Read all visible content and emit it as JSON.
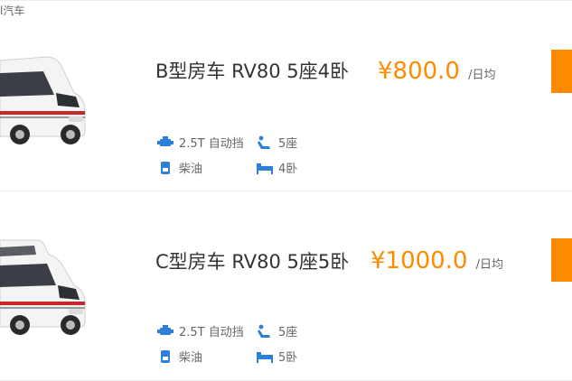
{
  "top_label": "l汽车",
  "cards": [
    {
      "title": "B型房车 RV80 5座4卧",
      "price": "¥800.0",
      "unit": "/日均",
      "engine": "2.5T 自动挡",
      "seats": "5座",
      "fuel": "柴油",
      "beds": "4卧"
    },
    {
      "title": "C型房车 RV80 5座5卧",
      "price": "¥1000.0",
      "unit": "/日均",
      "engine": "2.5T 自动挡",
      "seats": "5座",
      "fuel": "柴油",
      "beds": "5卧"
    }
  ],
  "colors": {
    "accent": "#ff8a00",
    "icon": "#2e7fd6"
  },
  "icons": [
    "engine-icon",
    "seat-icon",
    "fuel-icon",
    "bed-icon"
  ]
}
